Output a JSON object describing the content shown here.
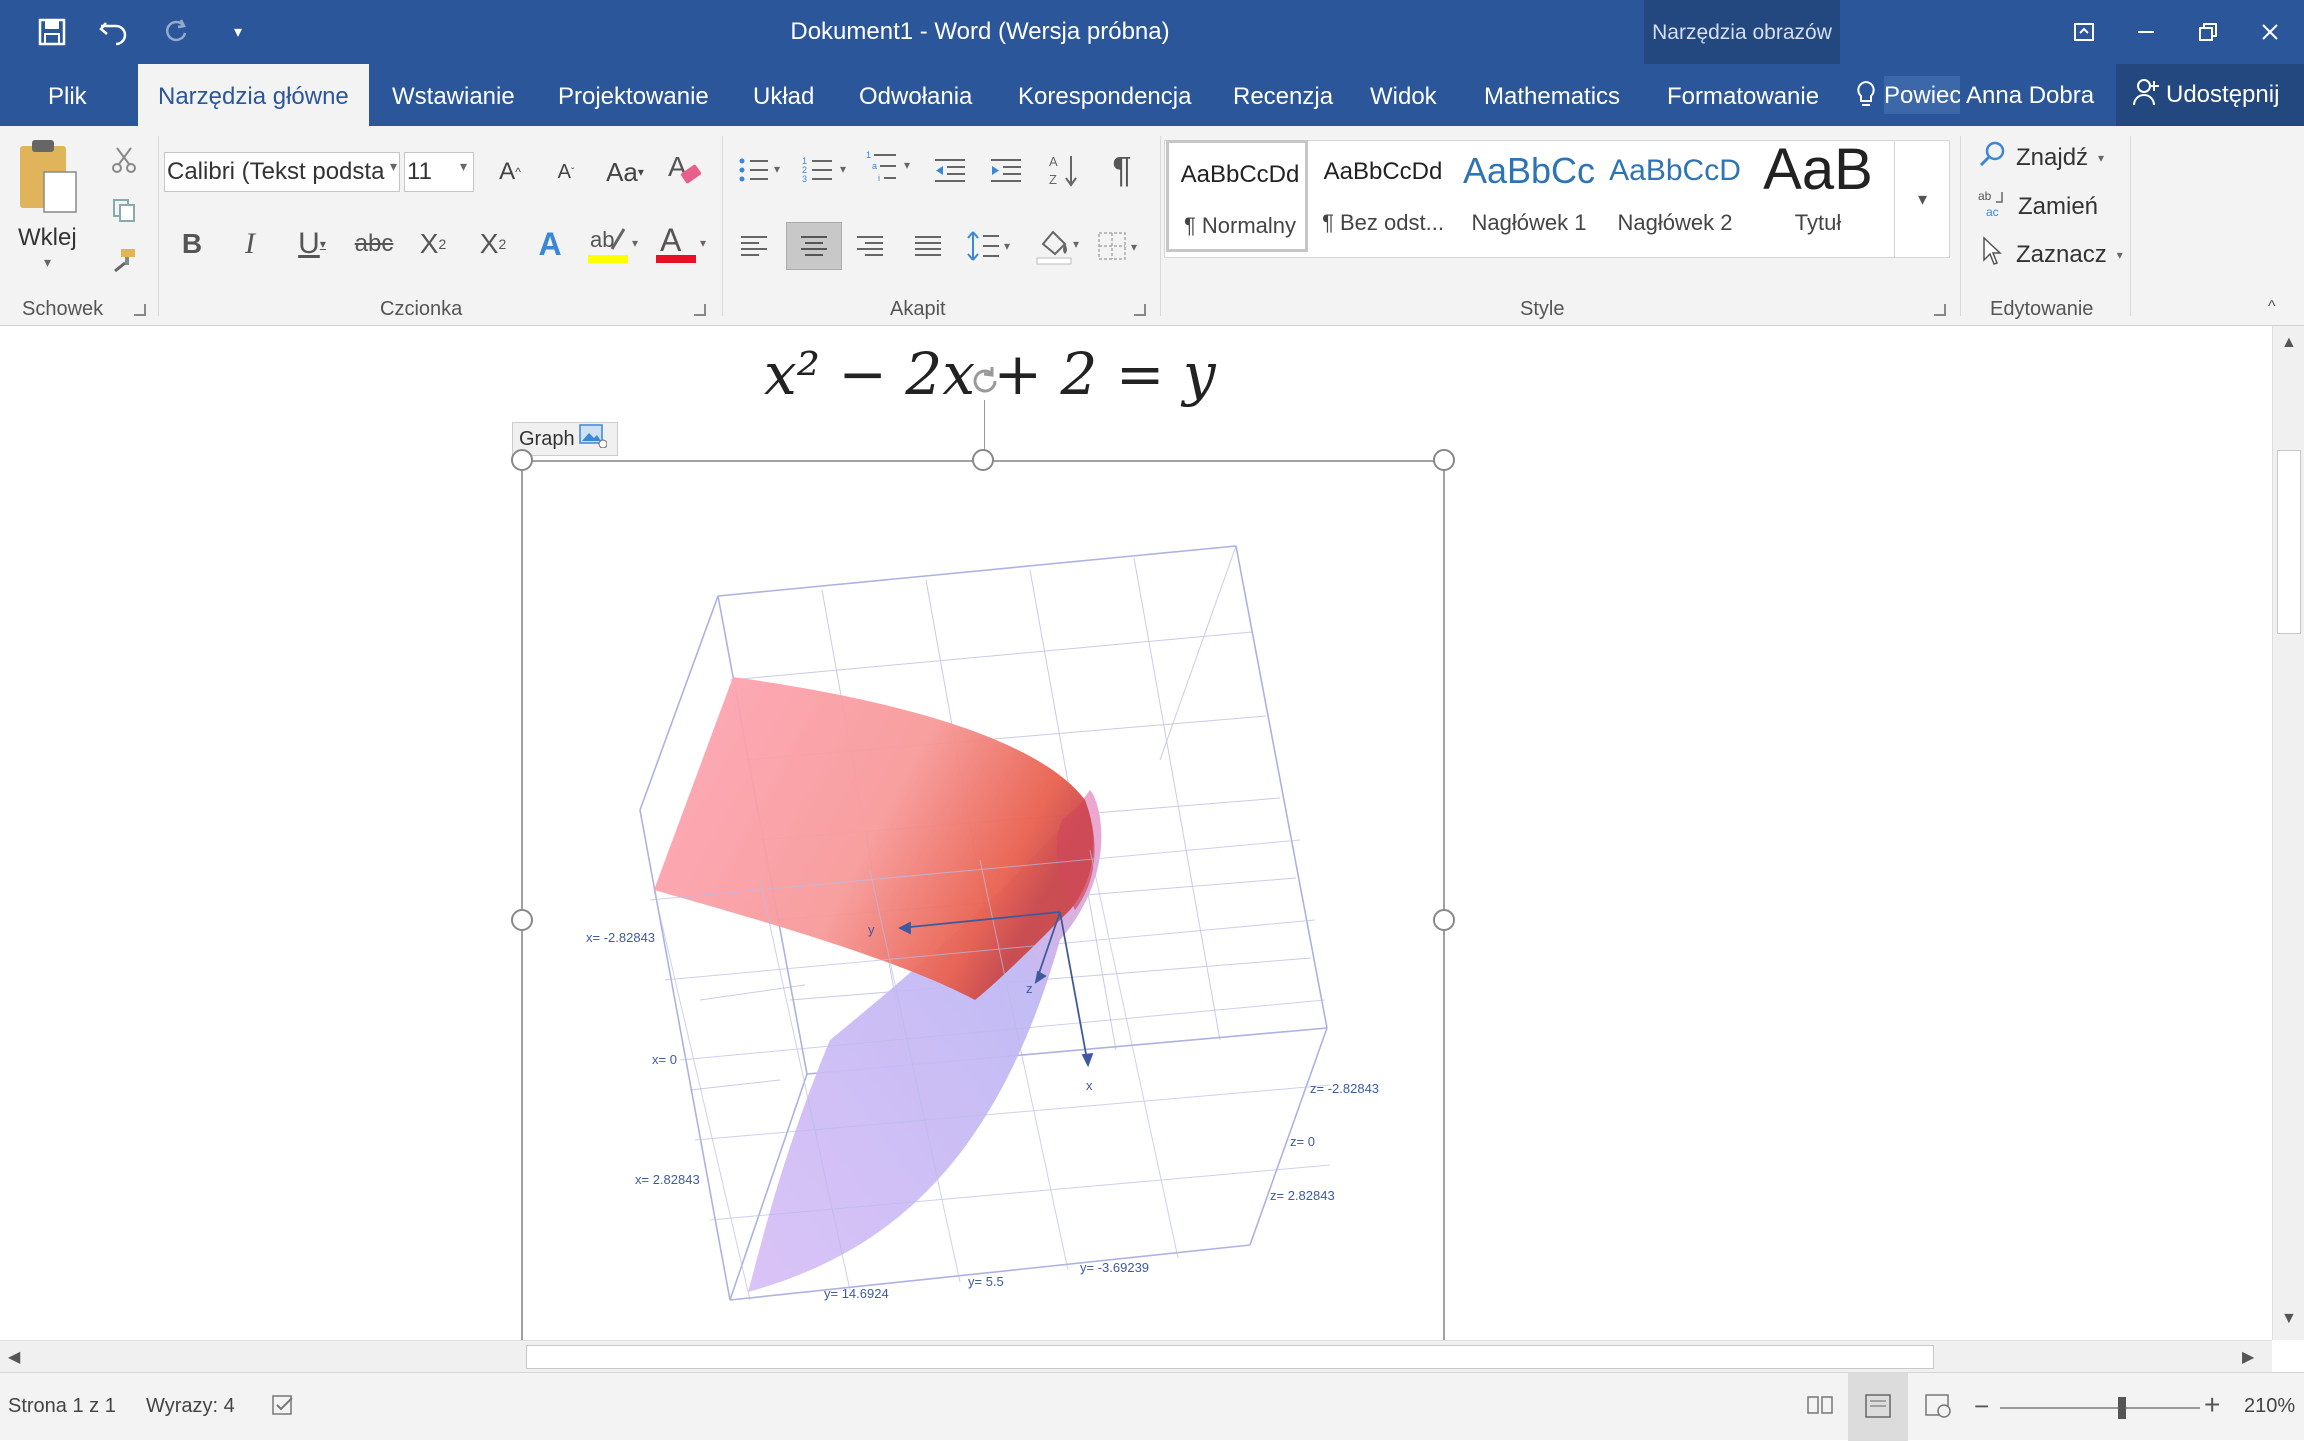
{
  "window": {
    "title": "Dokument1 - Word (Wersja próbna)",
    "context_tool": "Narzędzia obrazów"
  },
  "tabs": [
    "Plik",
    "Narzędzia główne",
    "Wstawianie",
    "Projektowanie",
    "Układ",
    "Odwołania",
    "Korespondencja",
    "Recenzja",
    "Widok",
    "Mathematics",
    "Formatowanie"
  ],
  "active_tab": "Narzędzia główne",
  "tell_me": "Powiec",
  "user": "Anna Dobra",
  "share_label": "Udostępnij",
  "clipboard": {
    "paste_label": "Wklej",
    "group_label": "Schowek"
  },
  "font": {
    "name": "Calibri (Tekst podsta",
    "size": "11",
    "group_label": "Czcionka"
  },
  "paragraph": {
    "group_label": "Akapit"
  },
  "styles": {
    "group_label": "Style",
    "items": [
      {
        "sample": "AaBbCcDd",
        "name": "¶ Normalny"
      },
      {
        "sample": "AaBbCcDd",
        "name": "¶ Bez odst..."
      },
      {
        "sample": "AaBbCc",
        "name": "Nagłówek 1"
      },
      {
        "sample": "AaBbCcD",
        "name": "Nagłówek 2"
      },
      {
        "sample": "AaB",
        "name": "Tytuł"
      }
    ]
  },
  "editing": {
    "group_label": "Edytowanie",
    "find": "Znajdź",
    "replace": "Zamień",
    "select": "Zaznacz"
  },
  "document": {
    "equation_lhs": "x² − 2x + 2",
    "equation_rhs": "y",
    "graph_tag": "Graph",
    "axis_labels": {
      "x_neg": "x= -2.82843",
      "x_zero": "x= 0",
      "x_pos": "x= 2.82843",
      "z_neg": "z= -2.82843",
      "z_zero": "z= 0",
      "z_pos": "z= 2.82843",
      "y_a": "y= 14.6924",
      "y_b": "y= 5.5",
      "y_c": "y= -3.69239",
      "y": "y",
      "z": "z",
      "x": "x"
    }
  },
  "status": {
    "page": "Strona 1 z 1",
    "words": "Wyrazy: 4",
    "zoom": "210%"
  },
  "colors": {
    "brand": "#2b579a",
    "surface_top": "#f4a0b0",
    "surface_bottom": "#c7b4f0"
  }
}
